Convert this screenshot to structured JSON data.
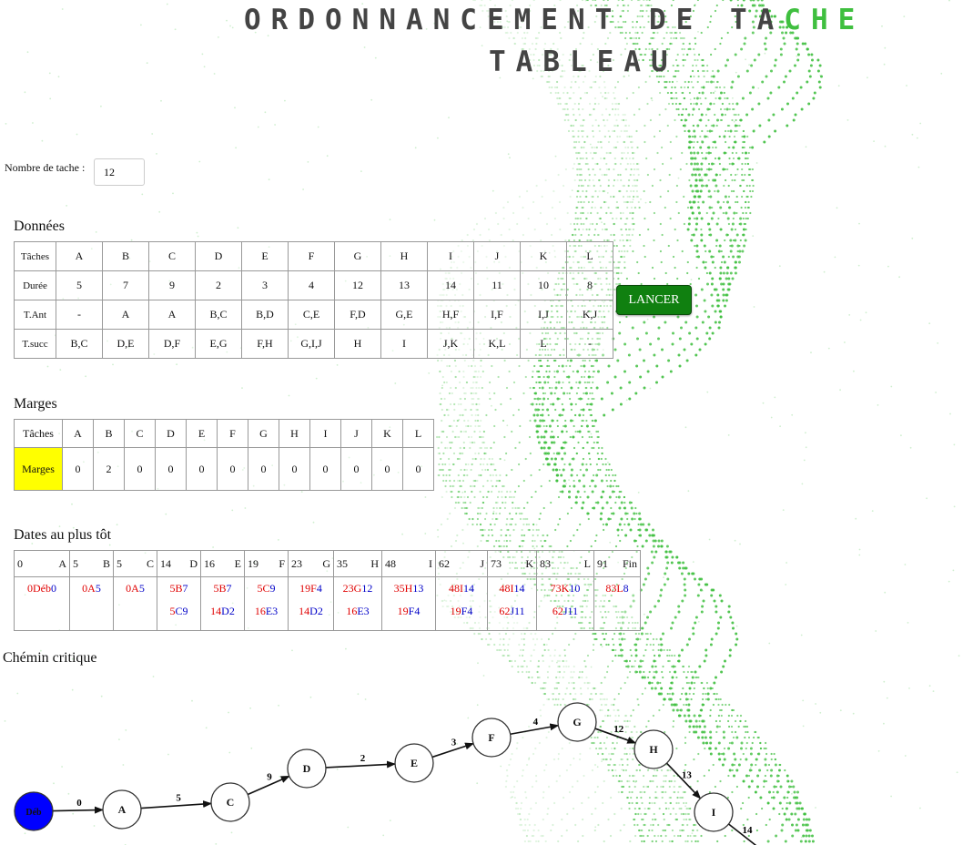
{
  "header": {
    "title_part1": "ORDONNANCEMENT DE TA",
    "title_part2": "CHE",
    "subtitle": "TABLEAU"
  },
  "task_count": {
    "label": "Nombre de tache :",
    "value": "12"
  },
  "data_section": {
    "title": "Données",
    "rows": [
      {
        "label": "Tâches",
        "cells": [
          "A",
          "B",
          "C",
          "D",
          "E",
          "F",
          "G",
          "H",
          "I",
          "J",
          "K",
          "L"
        ]
      },
      {
        "label": "Durée",
        "cells": [
          "5",
          "7",
          "9",
          "2",
          "3",
          "4",
          "12",
          "13",
          "14",
          "11",
          "10",
          "8"
        ]
      },
      {
        "label": "T.Ant",
        "cells": [
          "-",
          "A",
          "A",
          "B,C",
          "B,D",
          "C,E",
          "F,D",
          "G,E",
          "H,F",
          "I,F",
          "I,J",
          "K,J"
        ]
      },
      {
        "label": "T.succ",
        "cells": [
          "B,C",
          "D,E",
          "D,F",
          "E,G",
          "F,H",
          "G,I,J",
          "H",
          "I",
          "J,K",
          "K,L",
          "L",
          "-"
        ]
      }
    ]
  },
  "launch_button": {
    "label": "LANCER"
  },
  "margins_section": {
    "title": "Marges",
    "header_label": "Tâches",
    "tasks": [
      "A",
      "B",
      "C",
      "D",
      "E",
      "F",
      "G",
      "H",
      "I",
      "J",
      "K",
      "L"
    ],
    "row_label": "Marges",
    "values": [
      "0",
      "2",
      "0",
      "0",
      "0",
      "0",
      "0",
      "0",
      "0",
      "0",
      "0",
      "0"
    ]
  },
  "dates_section": {
    "title": "Dates au plus tôt",
    "columns": [
      {
        "date": "0",
        "task": "A",
        "rows": [
          [
            [
              "0",
              "r"
            ],
            [
              "Déb",
              "r"
            ],
            [
              "0",
              "b"
            ]
          ]
        ]
      },
      {
        "date": "5",
        "task": "B",
        "rows": [
          [
            [
              "0",
              "r"
            ],
            [
              "A",
              "r"
            ],
            [
              "5",
              "b"
            ]
          ]
        ]
      },
      {
        "date": "5",
        "task": "C",
        "rows": [
          [
            [
              "0",
              "r"
            ],
            [
              "A",
              "r"
            ],
            [
              "5",
              "b"
            ]
          ]
        ]
      },
      {
        "date": "14",
        "task": "D",
        "rows": [
          [
            [
              "5",
              "r"
            ],
            [
              "B",
              "r"
            ],
            [
              "7",
              "b"
            ]
          ],
          [
            [
              "5",
              "r"
            ],
            [
              "C",
              "b"
            ],
            [
              "9",
              "b"
            ]
          ]
        ]
      },
      {
        "date": "16",
        "task": "E",
        "rows": [
          [
            [
              "5",
              "r"
            ],
            [
              "B",
              "r"
            ],
            [
              "7",
              "b"
            ]
          ],
          [
            [
              "14",
              "r"
            ],
            [
              "D",
              "b"
            ],
            [
              "2",
              "b"
            ]
          ]
        ]
      },
      {
        "date": "19",
        "task": "F",
        "rows": [
          [
            [
              "5",
              "r"
            ],
            [
              "C",
              "r"
            ],
            [
              "9",
              "b"
            ]
          ],
          [
            [
              "16",
              "r"
            ],
            [
              "E",
              "b"
            ],
            [
              "3",
              "b"
            ]
          ]
        ]
      },
      {
        "date": "23",
        "task": "G",
        "rows": [
          [
            [
              "19",
              "r"
            ],
            [
              "F",
              "r"
            ],
            [
              "4",
              "b"
            ]
          ],
          [
            [
              "14",
              "r"
            ],
            [
              "D",
              "b"
            ],
            [
              "2",
              "b"
            ]
          ]
        ]
      },
      {
        "date": "35",
        "task": "H",
        "rows": [
          [
            [
              "23",
              "r"
            ],
            [
              "G",
              "r"
            ],
            [
              "12",
              "b"
            ]
          ],
          [
            [
              "16",
              "r"
            ],
            [
              "E",
              "b"
            ],
            [
              "3",
              "b"
            ]
          ]
        ]
      },
      {
        "date": "48",
        "task": "I",
        "rows": [
          [
            [
              "35",
              "r"
            ],
            [
              "H",
              "r"
            ],
            [
              "13",
              "b"
            ]
          ],
          [
            [
              "19",
              "r"
            ],
            [
              "F",
              "b"
            ],
            [
              "4",
              "b"
            ]
          ]
        ]
      },
      {
        "date": "62",
        "task": "J",
        "rows": [
          [
            [
              "48",
              "r"
            ],
            [
              "I",
              "r"
            ],
            [
              "14",
              "b"
            ]
          ],
          [
            [
              "19",
              "r"
            ],
            [
              "F",
              "b"
            ],
            [
              "4",
              "b"
            ]
          ]
        ]
      },
      {
        "date": "73",
        "task": "K",
        "rows": [
          [
            [
              "48",
              "r"
            ],
            [
              "I",
              "r"
            ],
            [
              "14",
              "b"
            ]
          ],
          [
            [
              "62",
              "r"
            ],
            [
              "J",
              "b"
            ],
            [
              "11",
              "b"
            ]
          ]
        ]
      },
      {
        "date": "83",
        "task": "L",
        "rows": [
          [
            [
              "73",
              "r"
            ],
            [
              "K",
              "r"
            ],
            [
              "10",
              "b"
            ]
          ],
          [
            [
              "62",
              "r"
            ],
            [
              "J",
              "b"
            ],
            [
              "11",
              "b"
            ]
          ]
        ]
      },
      {
        "date": "91",
        "task": "Fin",
        "rows": [
          [
            [
              "83",
              "r"
            ],
            [
              "L",
              "r"
            ],
            [
              "8",
              "b"
            ]
          ]
        ]
      }
    ]
  },
  "critical_path": {
    "title": "Chémin critique",
    "nodes": [
      {
        "id": "Déb",
        "label": "Déb",
        "fill": "#0000ff"
      },
      {
        "id": "A",
        "label": "A"
      },
      {
        "id": "C",
        "label": "C"
      },
      {
        "id": "D",
        "label": "D"
      },
      {
        "id": "E",
        "label": "E"
      },
      {
        "id": "F",
        "label": "F"
      },
      {
        "id": "G",
        "label": "G"
      },
      {
        "id": "H",
        "label": "H"
      },
      {
        "id": "I",
        "label": "I"
      }
    ],
    "edges": [
      {
        "from": "Déb",
        "to": "A",
        "label": "0"
      },
      {
        "from": "A",
        "to": "C",
        "label": "5"
      },
      {
        "from": "C",
        "to": "D",
        "label": "9"
      },
      {
        "from": "D",
        "to": "E",
        "label": "2"
      },
      {
        "from": "E",
        "to": "F",
        "label": "3"
      },
      {
        "from": "F",
        "to": "G",
        "label": "4"
      },
      {
        "from": "G",
        "to": "H",
        "label": "12"
      },
      {
        "from": "H",
        "to": "I",
        "label": "13"
      },
      {
        "from": "I",
        "to": "",
        "label": "14"
      }
    ]
  },
  "colors": {
    "accent_green": "#3fbf3f",
    "button_green": "#108010",
    "margin_highlight": "#ffff00",
    "date_red": "#e00000",
    "date_blue": "#0000c8"
  }
}
